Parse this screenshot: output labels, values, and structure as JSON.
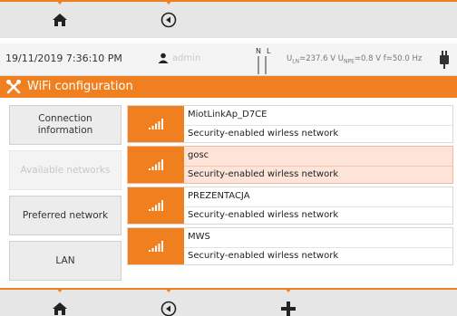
{
  "statusbar": {
    "datetime": "19/11/2019 7:36:10 PM",
    "user": "admin",
    "n_label": "N",
    "l_label": "L",
    "u_ln_label": "U",
    "u_ln_sub": "LN",
    "u_ln_value": "=237.6 V",
    "u_npe_label": "U",
    "u_npe_sub": "NPE",
    "u_npe_value": "=0.8 V",
    "freq": "f=50.0 Hz"
  },
  "title": "WiFi configuration",
  "menu": {
    "items": [
      {
        "label": "Connection information",
        "enabled": true
      },
      {
        "label": "Available networks",
        "enabled": false
      },
      {
        "label": "Preferred network",
        "enabled": true
      },
      {
        "label": "LAN",
        "enabled": true
      }
    ]
  },
  "networks": [
    {
      "ssid": "MiotLinkAp_D7CE",
      "description": "Security-enabled wirless network",
      "selected": false
    },
    {
      "ssid": "gosc",
      "description": "Security-enabled wirless network",
      "selected": true
    },
    {
      "ssid": "PREZENTACJA",
      "description": "Security-enabled wirless network",
      "selected": false
    },
    {
      "ssid": "MWS",
      "description": "Security-enabled wirless network",
      "selected": false
    }
  ],
  "colors": {
    "accent": "#f07f1f",
    "selected_row": "#fde3d8",
    "bar": "#e6e6e6"
  },
  "icons": {
    "top_nav": [
      "home-icon",
      "back-icon"
    ],
    "bottom_nav": [
      "home-icon",
      "back-icon",
      "add-icon"
    ],
    "title": "tools-icon",
    "status": [
      "user-icon",
      "plug-icon"
    ],
    "network": "wifi-signal-icon"
  }
}
